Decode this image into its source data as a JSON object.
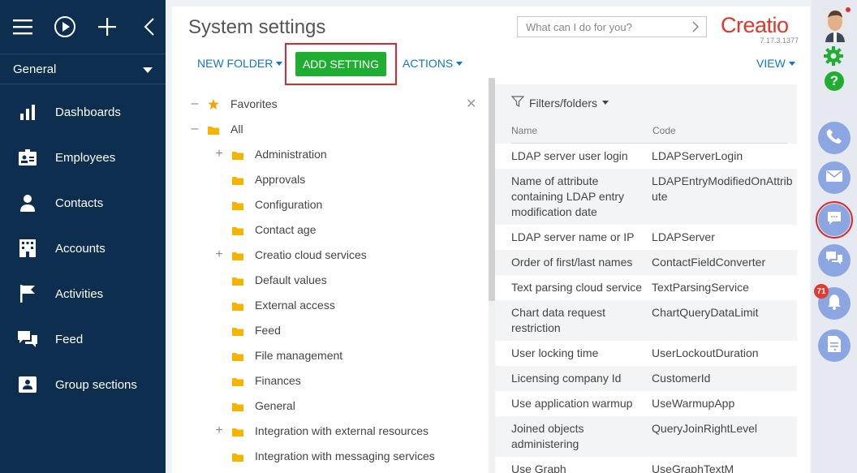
{
  "nav": {
    "workspace": "General",
    "items": [
      {
        "label": "Dashboards",
        "icon": "dashboards-icon"
      },
      {
        "label": "Employees",
        "icon": "employees-icon"
      },
      {
        "label": "Contacts",
        "icon": "contacts-icon"
      },
      {
        "label": "Accounts",
        "icon": "accounts-icon"
      },
      {
        "label": "Activities",
        "icon": "activities-icon"
      },
      {
        "label": "Feed",
        "icon": "feed-icon"
      },
      {
        "label": "Group sections",
        "icon": "group-sections-icon"
      }
    ]
  },
  "header": {
    "title": "System settings",
    "search_placeholder": "What can I do for you?",
    "brand": "Creatio",
    "version": "7.17.3.1377"
  },
  "toolbar": {
    "new_folder": "NEW FOLDER",
    "add_setting": "ADD SETTING",
    "actions": "ACTIONS",
    "view": "VIEW"
  },
  "tree": {
    "items": [
      {
        "label": "Favorites",
        "level": 0,
        "toggle": "–",
        "icon": "star"
      },
      {
        "label": "All",
        "level": 0,
        "toggle": "–",
        "icon": "folder"
      },
      {
        "label": "Administration",
        "level": 1,
        "toggle": "+",
        "icon": "folder"
      },
      {
        "label": "Approvals",
        "level": 1,
        "toggle": "",
        "icon": "folder"
      },
      {
        "label": "Configuration",
        "level": 1,
        "toggle": "",
        "icon": "folder"
      },
      {
        "label": "Contact age",
        "level": 1,
        "toggle": "",
        "icon": "folder"
      },
      {
        "label": "Creatio cloud services",
        "level": 1,
        "toggle": "+",
        "icon": "folder"
      },
      {
        "label": "Default values",
        "level": 1,
        "toggle": "",
        "icon": "folder"
      },
      {
        "label": "External access",
        "level": 1,
        "toggle": "",
        "icon": "folder"
      },
      {
        "label": "Feed",
        "level": 1,
        "toggle": "",
        "icon": "folder"
      },
      {
        "label": "File management",
        "level": 1,
        "toggle": "",
        "icon": "folder"
      },
      {
        "label": "Finances",
        "level": 1,
        "toggle": "",
        "icon": "folder"
      },
      {
        "label": "General",
        "level": 1,
        "toggle": "",
        "icon": "folder"
      },
      {
        "label": "Integration with external resources",
        "level": 1,
        "toggle": "+",
        "icon": "folder"
      },
      {
        "label": "Integration with messaging services",
        "level": 1,
        "toggle": "",
        "icon": "folder"
      }
    ]
  },
  "list": {
    "filters_label": "Filters/folders",
    "columns": [
      "Name",
      "Code"
    ],
    "rows": [
      {
        "name": "LDAP server user login",
        "code": "LDAPServerLogin"
      },
      {
        "name": "Name of attribute containing LDAP entry modification date",
        "code": "LDAPEntryModifiedOnAttribute"
      },
      {
        "name": "LDAP server name or IP",
        "code": "LDAPServer"
      },
      {
        "name": "Order of first/last names",
        "code": "ContactFieldConverter"
      },
      {
        "name": "Text parsing cloud service",
        "code": "TextParsingService"
      },
      {
        "name": "Chart data request restriction",
        "code": "ChartQueryDataLimit"
      },
      {
        "name": "User locking time",
        "code": "UserLockoutDuration"
      },
      {
        "name": "Licensing company Id",
        "code": "CustomerId"
      },
      {
        "name": "Use application warmup",
        "code": "UseWarmupApp"
      },
      {
        "name": "Joined objects administering",
        "code": "QueryJoinRightLevel"
      },
      {
        "name": "Use Graph",
        "code": "UseGraphTextM"
      }
    ]
  },
  "rightbar": {
    "notification_count": "71"
  },
  "colors": {
    "nav_bg": "#0d2e4e",
    "accent_blue": "#0e78c8",
    "add_green": "#1fae32",
    "highlight_red": "#d42a2a",
    "folder_yellow": "#f4b400"
  }
}
